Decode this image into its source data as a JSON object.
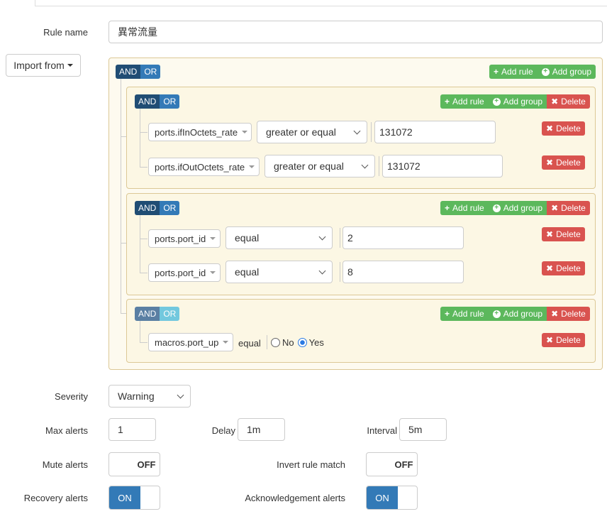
{
  "rule_name": {
    "label": "Rule name",
    "value": "異常流量"
  },
  "import_from": {
    "label": "Import from"
  },
  "builder": {
    "and_label": "AND",
    "or_label": "OR",
    "add_rule_label": "Add rule",
    "add_group_label": "Add group",
    "delete_label": "Delete",
    "groups": [
      {
        "rules": [
          {
            "field": "ports.ifInOctets_rate",
            "operator": "greater or equal",
            "value": "131072"
          },
          {
            "field": "ports.ifOutOctets_rate",
            "operator": "greater or equal",
            "value": "131072"
          }
        ]
      },
      {
        "rules": [
          {
            "field": "ports.port_id",
            "operator": "equal",
            "value": "2"
          },
          {
            "field": "ports.port_id",
            "operator": "equal",
            "value": "8"
          }
        ]
      },
      {
        "rules": [
          {
            "field": "macros.port_up",
            "operator": "equal",
            "radio_no": "No",
            "radio_yes": "Yes",
            "selected": "Yes"
          }
        ]
      }
    ]
  },
  "severity": {
    "label": "Severity",
    "value": "Warning"
  },
  "max_alerts": {
    "label": "Max alerts",
    "value": "1"
  },
  "delay": {
    "label": "Delay",
    "value": "1m"
  },
  "interval": {
    "label": "Interval",
    "value": "5m"
  },
  "mute_alerts": {
    "label": "Mute alerts",
    "state": "OFF"
  },
  "invert_rule_match": {
    "label": "Invert rule match",
    "state": "OFF"
  },
  "recovery_alerts": {
    "label": "Recovery alerts",
    "state": "ON"
  },
  "acknowledgement_alerts": {
    "label": "Acknowledgement alerts",
    "state": "ON"
  },
  "colors": {
    "primary": "#337ab7",
    "success": "#5cb85c",
    "danger": "#d9534f",
    "group_border": "#dcc896"
  }
}
